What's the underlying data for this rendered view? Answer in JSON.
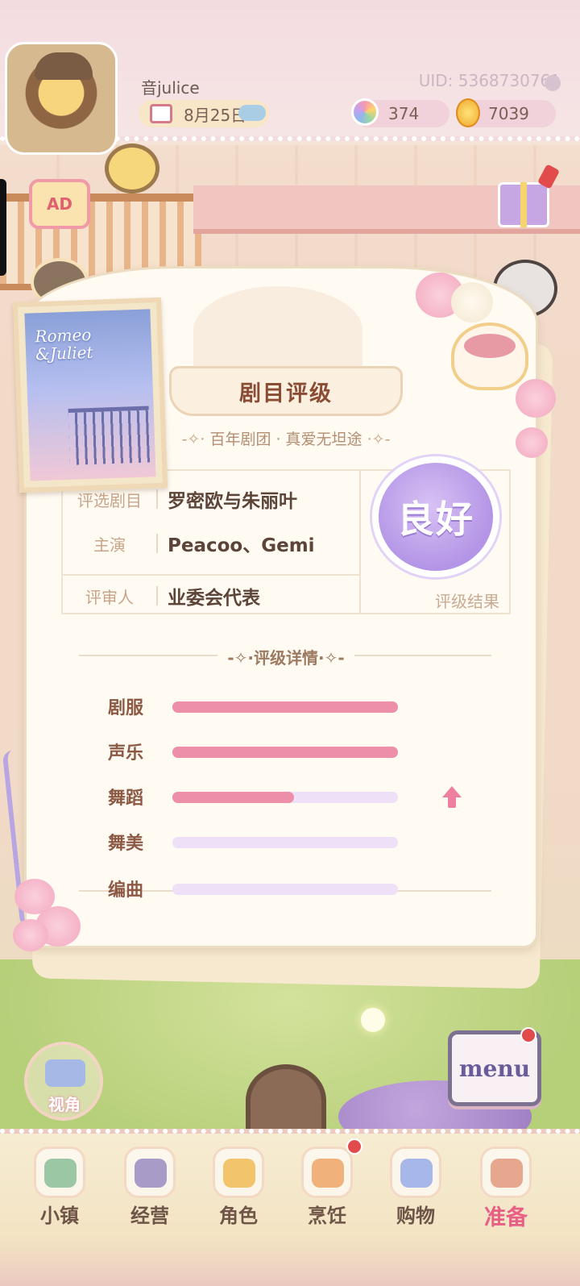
{
  "hud": {
    "nickname": "音julice",
    "uid": "UID: 5368730761",
    "date": "8月25日",
    "gems": "374",
    "coins": "7039"
  },
  "ad_label": "AD",
  "poster": {
    "title_line1": "Romeo",
    "title_line2": "&Juliet"
  },
  "card": {
    "title": "剧目评级",
    "subtitle": "百年剧团 · 真爱无坦途",
    "rows": [
      {
        "label": "评选剧目",
        "value": "罗密欧与朱丽叶"
      },
      {
        "label": "主演",
        "value": "Peacoo、Gemi"
      },
      {
        "label": "评审人",
        "value": "业委会代表"
      }
    ],
    "grade": "良好",
    "grade_caption": "评级结果",
    "details_title": "评级详情",
    "stats": [
      {
        "label": "剧服",
        "fraction": 1.0
      },
      {
        "label": "声乐",
        "fraction": 1.0
      },
      {
        "label": "舞蹈",
        "fraction": 0.54
      },
      {
        "label": "舞美",
        "fraction": 0.0
      },
      {
        "label": "编曲",
        "fraction": 0.0
      }
    ]
  },
  "camera_label": "视角",
  "menu_label": "menu",
  "nav": [
    {
      "label": "小镇",
      "icon": "map-icon",
      "color": "#9cc7a4"
    },
    {
      "label": "经营",
      "icon": "briefcase-icon",
      "color": "#a99bc7"
    },
    {
      "label": "角色",
      "icon": "character-icon",
      "color": "#f2c46b"
    },
    {
      "label": "烹饪",
      "icon": "sandwich-icon",
      "color": "#f0b27a"
    },
    {
      "label": "购物",
      "icon": "shopping-bag-icon",
      "color": "#a8b7ea"
    },
    {
      "label": "准备",
      "icon": "basket-icon",
      "color": "#e7a78f",
      "active": true
    }
  ],
  "colors": {
    "accent_pink": "#ee8fa9",
    "track_lavender": "#ede0f7",
    "grade_purple": "#b394e6"
  }
}
